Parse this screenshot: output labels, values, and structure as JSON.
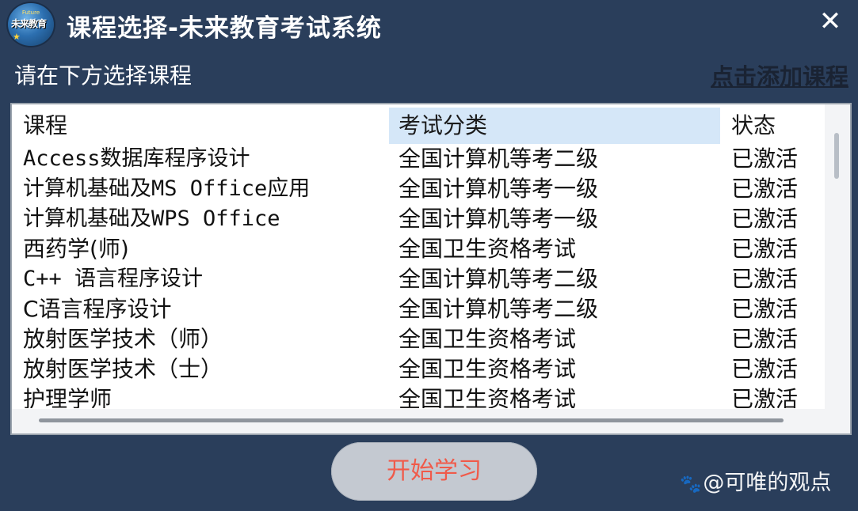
{
  "window": {
    "title": "课程选择-未来教育考试系统",
    "close_glyph": "✕",
    "logo_lines": [
      "Future",
      "未来教育",
      "★"
    ]
  },
  "subtitle": "请在下方选择课程",
  "add_course_link": "点击添加课程",
  "table": {
    "headers": {
      "course": "课程",
      "category": "考试分类",
      "status": "状态"
    },
    "rows": [
      {
        "course": "Access数据库程序设计",
        "category": "全国计算机等考二级",
        "status": "已激活"
      },
      {
        "course": "计算机基础及MS Office应用",
        "category": "全国计算机等考一级",
        "status": "已激活"
      },
      {
        "course": "计算机基础及WPS Office",
        "category": "全国计算机等考一级",
        "status": "已激活"
      },
      {
        "course": "西药学(师)",
        "category": "全国卫生资格考试",
        "status": "已激活"
      },
      {
        "course": "C++ 语言程序设计",
        "category": "全国计算机等考二级",
        "status": "已激活"
      },
      {
        "course": "C语言程序设计",
        "category": "全国计算机等考二级",
        "status": "已激活"
      },
      {
        "course": "放射医学技术（师）",
        "category": "全国卫生资格考试",
        "status": "已激活"
      },
      {
        "course": "放射医学技术（士）",
        "category": "全国卫生资格考试",
        "status": "已激活"
      },
      {
        "course": "护理学师",
        "category": "全国卫生资格考试",
        "status": "已激活"
      }
    ]
  },
  "start_button": "开始学习",
  "watermark": {
    "paw": "🐾",
    "text": "@可唯的观点"
  },
  "colors": {
    "background": "#2a3e5b",
    "header_highlight": "#d5e7f8",
    "start_text": "#f05a4a",
    "start_bg": "#c4c9d1"
  }
}
